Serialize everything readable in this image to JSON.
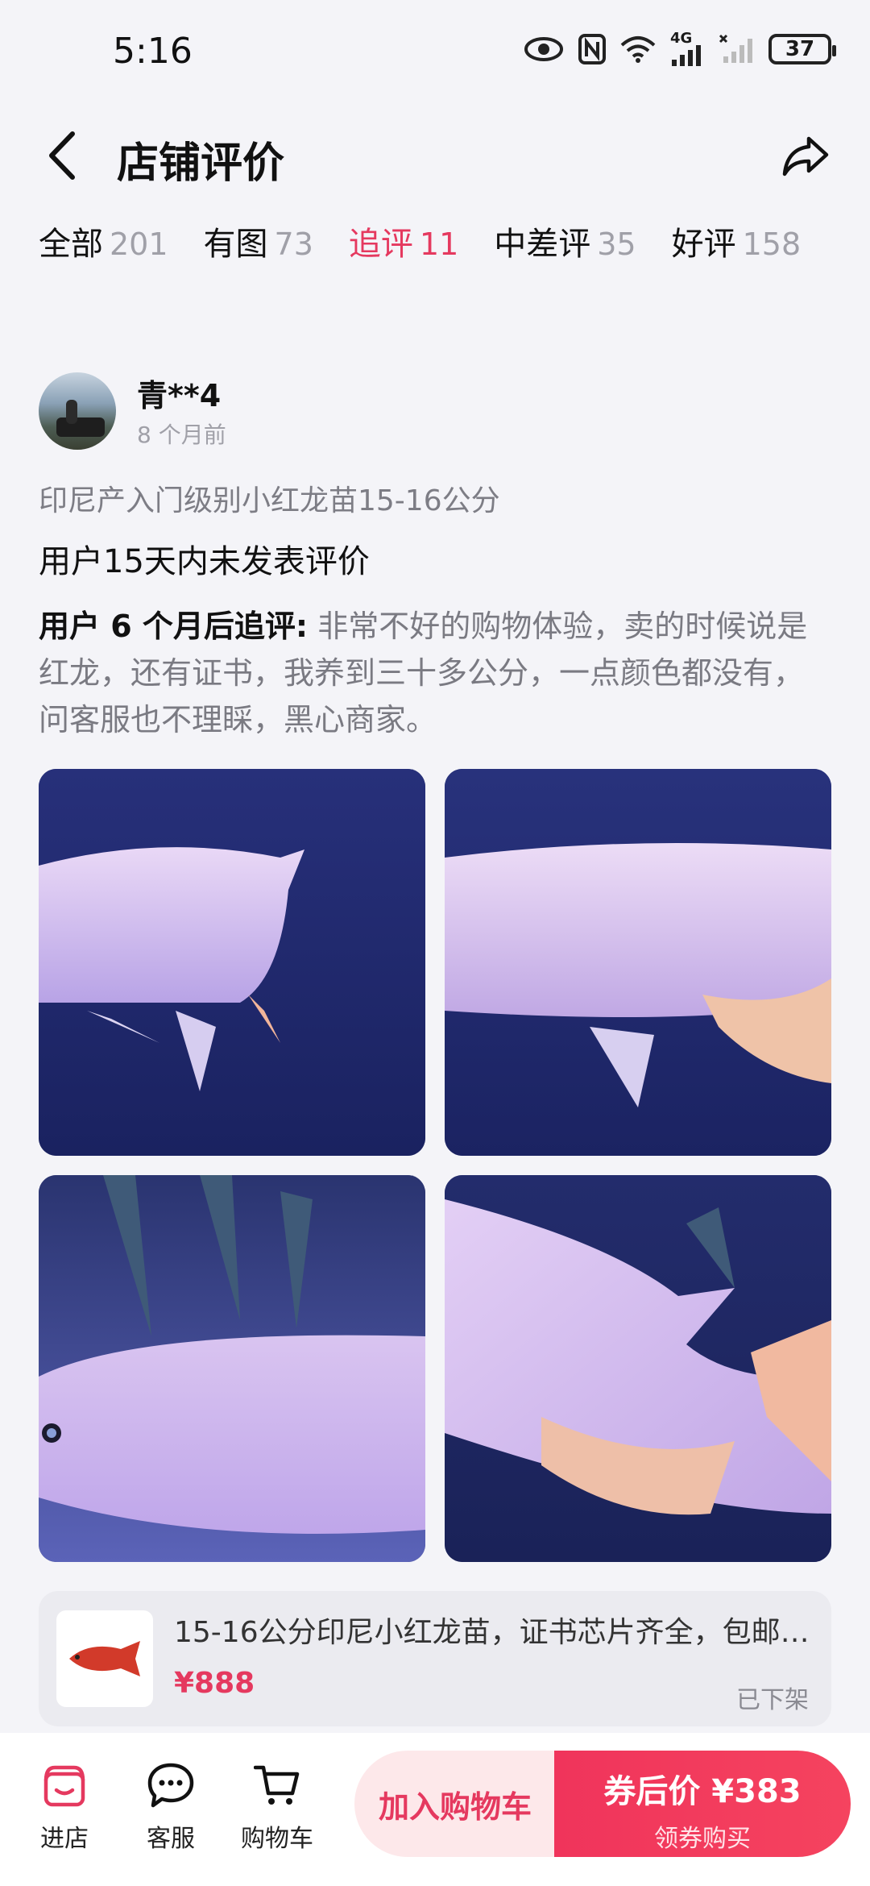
{
  "status_bar": {
    "time": "5:16",
    "network": "4G",
    "battery": "37"
  },
  "header": {
    "title": "店铺评价"
  },
  "tabs": [
    {
      "label": "全部",
      "count": "201",
      "active": false
    },
    {
      "label": "有图",
      "count": "73",
      "active": false
    },
    {
      "label": "追评",
      "count": "11",
      "active": true
    },
    {
      "label": "中差评",
      "count": "35",
      "active": false
    },
    {
      "label": "好评",
      "count": "158",
      "active": false
    }
  ],
  "review": {
    "username": "青**4",
    "time_ago": "8 个月前",
    "product_spec": "印尼产入门级别小红龙苗15-16公分",
    "text": "用户15天内未发表评价",
    "followup_label": "用户 6 个月后追评:",
    "followup_text": "非常不好的购物体验，卖的时候说是红龙，还有证书，我养到三十多公分，一点颜色都没有，问客服也不理睬，黑心商家。"
  },
  "product": {
    "title": "15-16公分印尼小红龙苗，证书芯片齐全，包邮…",
    "price": "¥888",
    "status": "已下架"
  },
  "bottom_nav": {
    "store": "进店",
    "service": "客服",
    "cart": "购物车"
  },
  "actions": {
    "add_to_cart": "加入购物车",
    "buy_main": "券后价 ¥383",
    "buy_sub": "领券购买"
  },
  "colors": {
    "accent": "#e5395f",
    "background": "#f4f4f8"
  }
}
